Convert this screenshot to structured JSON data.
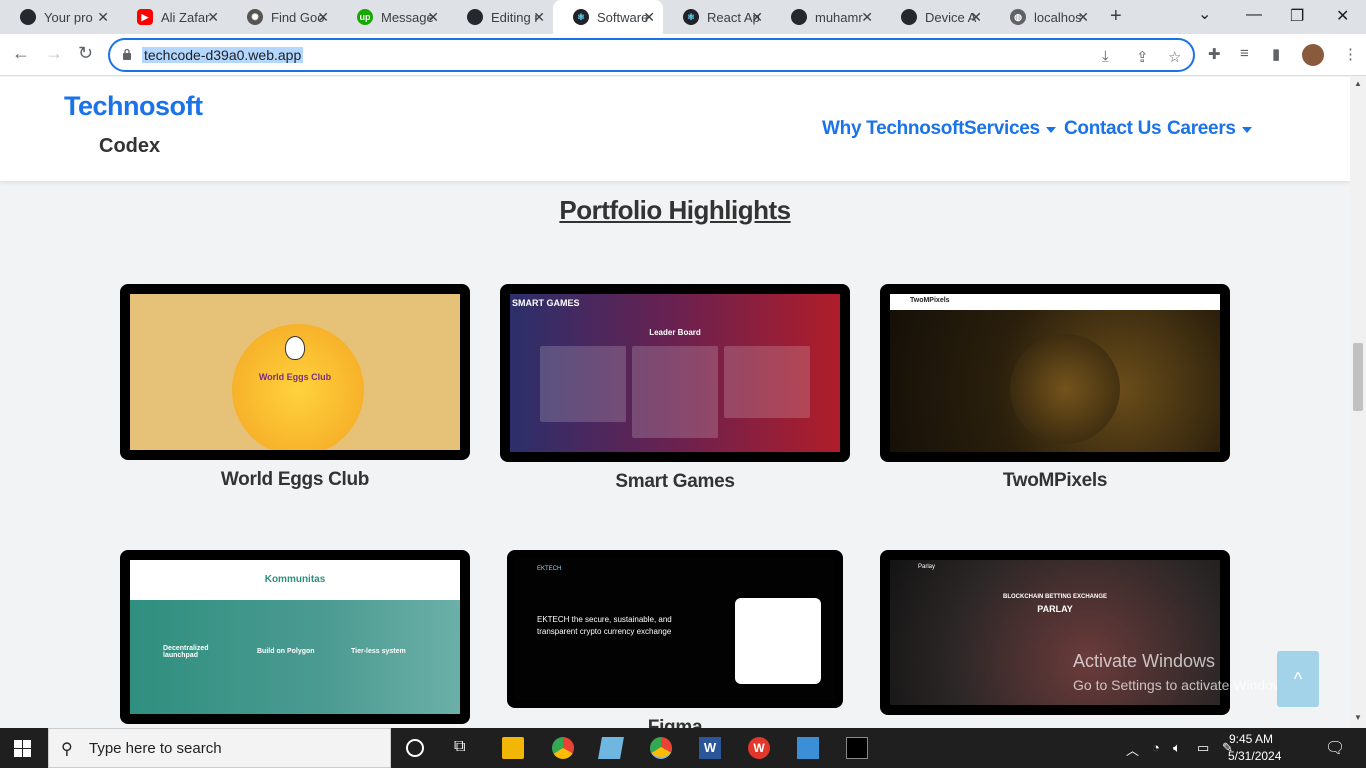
{
  "browser": {
    "tabs": [
      {
        "label": "Your pro",
        "icon": "github-icon"
      },
      {
        "label": "Ali Zafar",
        "icon": "youtube-icon"
      },
      {
        "label": "Find Goo",
        "icon": "openai-icon"
      },
      {
        "label": "Message",
        "icon": "upwork-icon"
      },
      {
        "label": "Editing r",
        "icon": "github-icon"
      },
      {
        "label": "Software",
        "icon": "react-icon",
        "active": true
      },
      {
        "label": "React Ap",
        "icon": "react-icon"
      },
      {
        "label": "muhamr",
        "icon": "github-icon"
      },
      {
        "label": "Device A",
        "icon": "github-icon"
      },
      {
        "label": "localhos",
        "icon": "globe-icon"
      }
    ],
    "url": "techcode-d39a0.web.app"
  },
  "site": {
    "brand_main": "Technosoft",
    "brand_sub": "Codex",
    "nav": [
      {
        "label": "Why Technosoft",
        "dropdown": false
      },
      {
        "label": "Services",
        "dropdown": true
      },
      {
        "label": "Contact Us",
        "dropdown": false
      },
      {
        "label": "Careers",
        "dropdown": true
      }
    ],
    "section_title": "Portfolio Highlights",
    "portfolio": [
      {
        "caption": "World Eggs Club",
        "thumb_title": "World Eggs Club"
      },
      {
        "caption": "Smart Games",
        "thumb_brand": "SMART GAMES",
        "thumb_title": "Leader Board"
      },
      {
        "caption": "TwoMPixels",
        "thumb_brand": "TwoMPixels"
      },
      {
        "caption": "",
        "thumb_title": "Kommunitas",
        "features": [
          "Decentralized launchpad",
          "Build on Polygon",
          "Tier-less system"
        ]
      },
      {
        "caption": "Figma",
        "thumb_brand": "EKTECH",
        "thumb_title": "EKTECH the secure, sustainable, and transparent crypto currency exchange"
      },
      {
        "caption": "",
        "thumb_brand": "Parlay",
        "thumb_title": "BLOCKCHAIN BETTING EXCHANGE",
        "thumb_sub": "PARLAY"
      }
    ],
    "scroll_top_label": "^"
  },
  "os": {
    "watermark_title": "Activate Windows",
    "watermark_text": "Go to Settings to activate Windows.",
    "search_placeholder": "Type here to search",
    "time": "9:45 AM",
    "date": "5/31/2024"
  }
}
